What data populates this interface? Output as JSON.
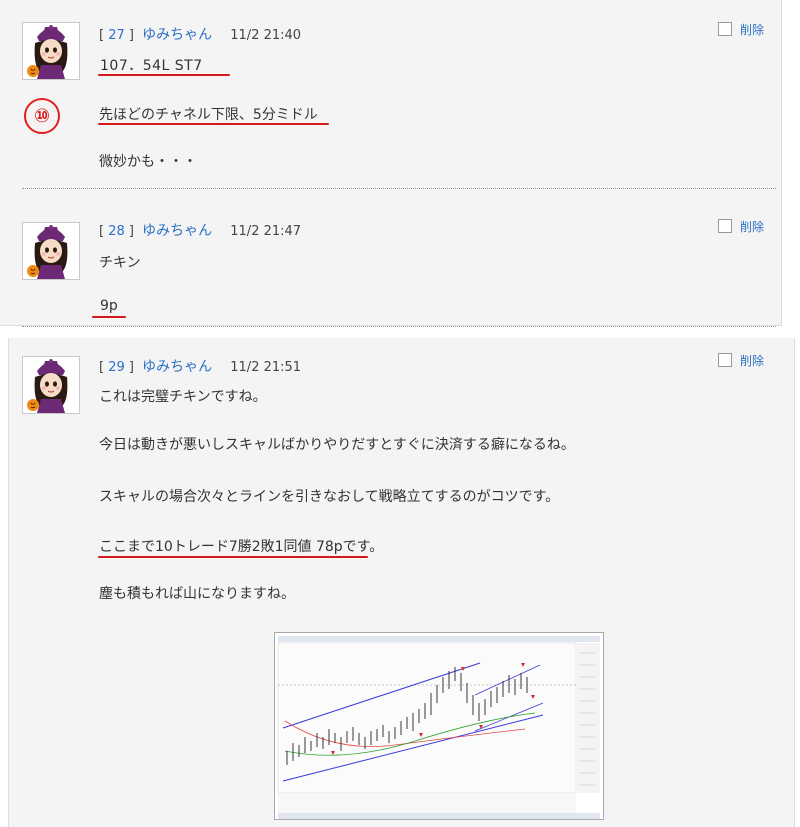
{
  "posts": [
    {
      "num": "27",
      "name": "ゆみちゃん",
      "time": "11/2 21:40",
      "delete_label": "削除",
      "lines": [
        "107．54L ST7",
        "先ほどのチャネル下限、5分ミドル",
        "微妙かも・・・"
      ]
    },
    {
      "num": "28",
      "name": "ゆみちゃん",
      "time": "11/2 21:47",
      "delete_label": "削除",
      "lines": [
        "チキン",
        "9p"
      ]
    },
    {
      "num": "29",
      "name": "ゆみちゃん",
      "time": "11/2 21:51",
      "delete_label": "削除",
      "lines": [
        "これは完璧チキンですね。",
        "今日は動きが悪いしスキャルばかりやりだすとすぐに決済する癖になるね。",
        "スキャルの場合次々とラインを引きなおして戦略立てするのがコツです。",
        "ここまで10トレード7勝2敗1同値 78pです。",
        "塵も積もれば山になりますね。"
      ]
    }
  ],
  "annotation_number": "⑩",
  "colors": {
    "accent_red": "#d21a1a",
    "link_blue": "#2b6fc7"
  },
  "icons": [
    "avatar-icon",
    "checkbox-icon"
  ]
}
